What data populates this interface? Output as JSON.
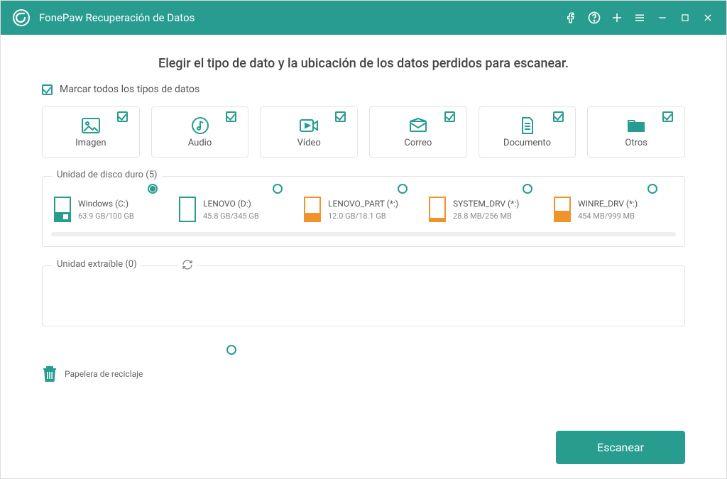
{
  "app": {
    "title": "FonePaw Recuperación de Datos"
  },
  "headline": "Elegir el tipo de dato y la ubicación de los datos perdidos para escanear.",
  "select_all_label": "Marcar todos los tipos de datos",
  "types": {
    "image": "Imagen",
    "audio": "Audio",
    "video": "Vídeo",
    "mail": "Correo",
    "document": "Documento",
    "others": "Otros"
  },
  "hdd_section_title": "Unidad de disco duro (5)",
  "removable_section_title": "Unidad extraíble (0)",
  "drives": [
    {
      "name": "Windows (C:)",
      "size": "63.9 GB/100 GB",
      "color": "teal",
      "fill": 36,
      "selected": true,
      "win": true
    },
    {
      "name": "LENOVO (D:)",
      "size": "45.8 GB/345 GB",
      "color": "teal",
      "fill": 0,
      "selected": false,
      "win": false
    },
    {
      "name": "LENOVO_PART (*:)",
      "size": "12.0 GB/18.1 GB",
      "color": "orange",
      "fill": 34,
      "selected": false,
      "win": false
    },
    {
      "name": "SYSTEM_DRV (*:)",
      "size": "28.8 MB/256 MB",
      "color": "orange",
      "fill": 12,
      "selected": false,
      "win": false
    },
    {
      "name": "WINRE_DRV (*:)",
      "size": "454 MB/999 MB",
      "color": "orange",
      "fill": 45,
      "selected": false,
      "win": false
    }
  ],
  "trash_label": "Papelera de reciclaje",
  "scan_label": "Escanear"
}
